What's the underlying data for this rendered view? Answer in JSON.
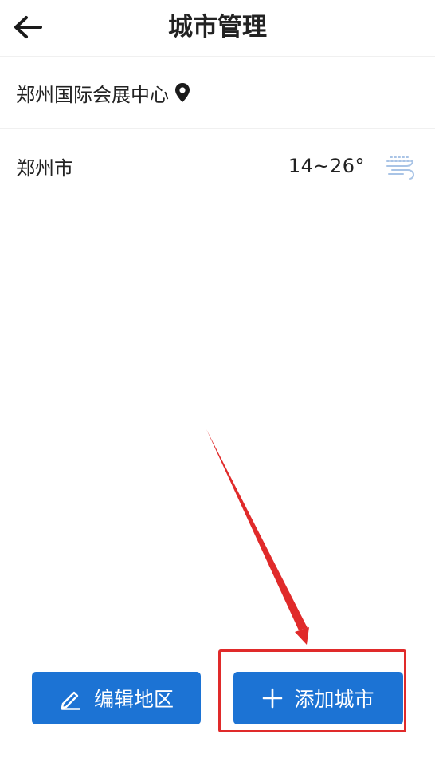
{
  "header": {
    "title": "城市管理",
    "back_icon": "arrow-left-icon"
  },
  "location_row": {
    "label": "郑州国际会展中心",
    "icon": "location-pin-icon"
  },
  "city_row": {
    "name": "郑州市",
    "temperature": "14~26°",
    "weather_icon": "wind-icon"
  },
  "footer": {
    "edit_label": "编辑地区",
    "edit_icon": "pencil-icon",
    "add_label": "添加城市",
    "add_icon": "plus-icon"
  },
  "colors": {
    "primary": "#1c73d4",
    "annotation": "#e02a2a",
    "weather_icon": "#a9c4e6"
  }
}
